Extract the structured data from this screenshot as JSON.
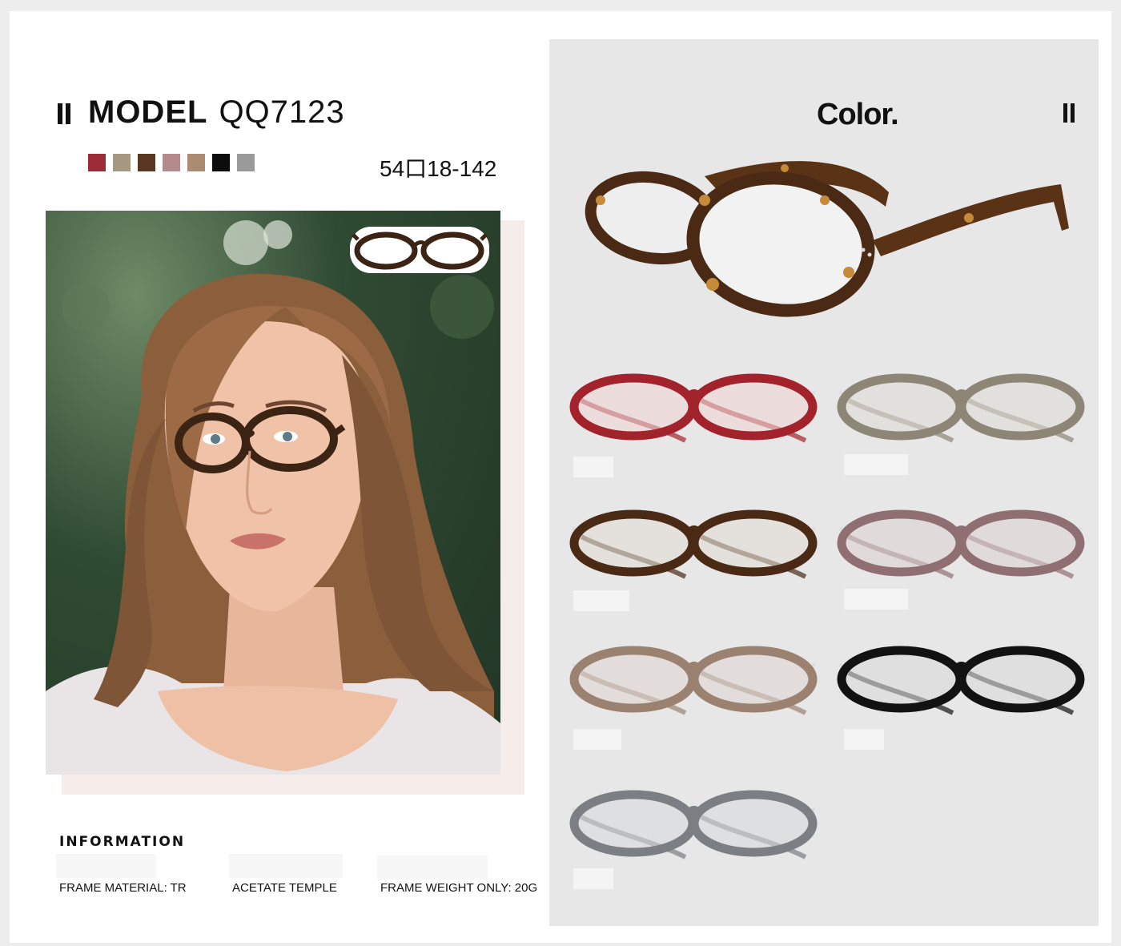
{
  "model": {
    "label": "MODEL",
    "number": "QQ7123"
  },
  "size_text": "54口18-142",
  "swatches": [
    {
      "name": "red",
      "color": "#9d2b35"
    },
    {
      "name": "olive-grey",
      "color": "#a69780"
    },
    {
      "name": "tortoise",
      "color": "#5a3720"
    },
    {
      "name": "pink",
      "color": "#b48a8c"
    },
    {
      "name": "brown",
      "color": "#ad8b73"
    },
    {
      "name": "black",
      "color": "#0d0d0d"
    },
    {
      "name": "grey",
      "color": "#9a9a9a"
    }
  ],
  "info": {
    "heading": "INFORMATION",
    "items": [
      "FRAME MATERIAL: TR",
      "ACETATE TEMPLE",
      "FRAME WEIGHT ONLY: 20G"
    ]
  },
  "color_panel": {
    "title": "Color."
  },
  "variants": [
    {
      "name": "red",
      "frame": "#a3232c",
      "lens": "#f1d3d3"
    },
    {
      "name": "olive-grey",
      "frame": "#8d8676",
      "lens": "#dcdad3"
    },
    {
      "name": "tortoise",
      "frame": "#4a2a14",
      "lens": "#e2ddd6"
    },
    {
      "name": "pink",
      "frame": "#8f6f72",
      "lens": "#dcd0d0"
    },
    {
      "name": "brown",
      "frame": "#9a8170",
      "lens": "#ded6cf"
    },
    {
      "name": "black",
      "frame": "#121212",
      "lens": "#d9d9d9"
    },
    {
      "name": "grey",
      "frame": "#7b7e82",
      "lens": "#d6d8da"
    }
  ],
  "colors": {
    "panel": "#e7e7e7",
    "text": "#111111"
  }
}
